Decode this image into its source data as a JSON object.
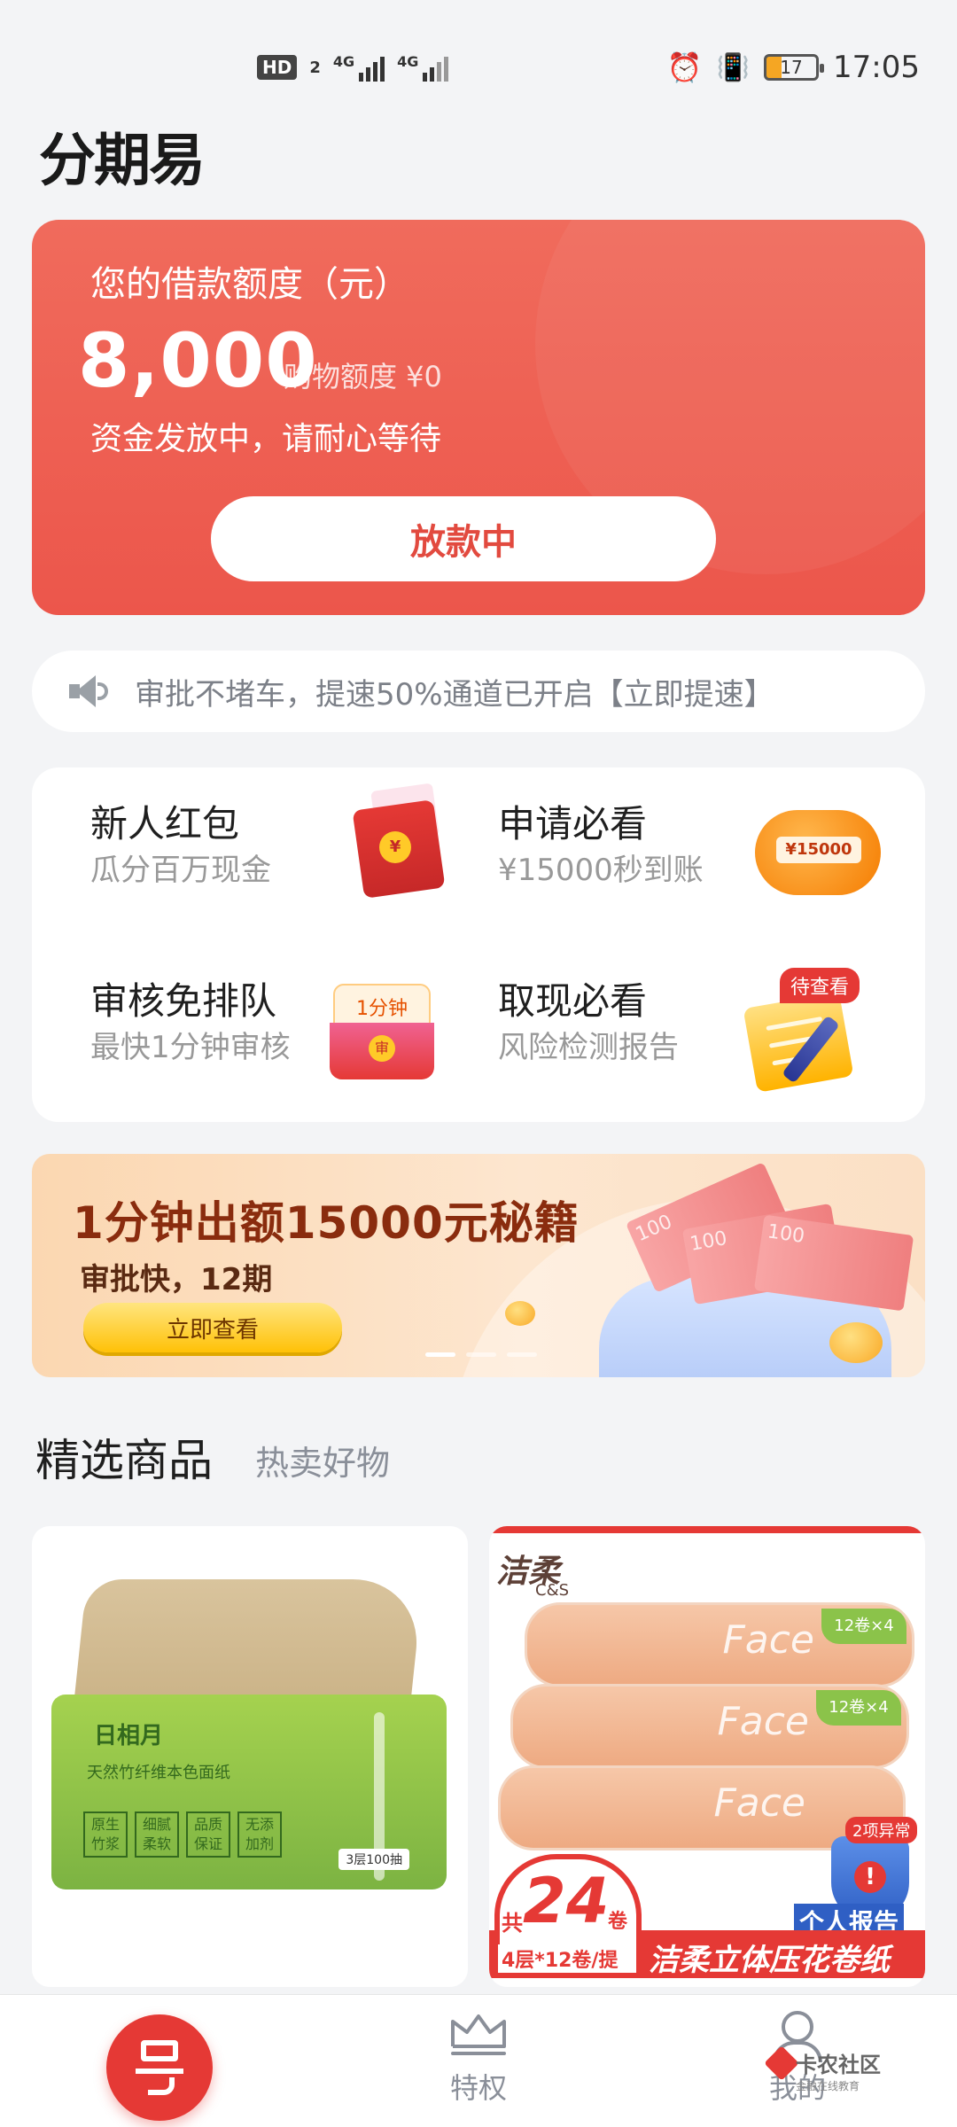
{
  "status_bar": {
    "hd": "HD",
    "sim": "2",
    "net1": "4G",
    "net2": "4G",
    "battery": "17",
    "time": "17:05"
  },
  "app": {
    "logo": "分期易"
  },
  "credit": {
    "title": "您的借款额度（元）",
    "amount": "8,000",
    "shopping_quota": "购物额度 ¥0",
    "status": "资金发放中，请耐心等待",
    "button": "放款中"
  },
  "notice": {
    "text": "审批不堵车，提速50%通道已开启【立即提速】"
  },
  "features": [
    {
      "title": "新人红包",
      "subtitle": "瓜分百万现金",
      "icon": "red-packet-icon",
      "coin": "¥"
    },
    {
      "title": "申请必看",
      "subtitle": "¥15000秒到账",
      "icon": "piggy-bank-icon",
      "label": "¥15000"
    },
    {
      "title": "审核免排队",
      "subtitle": "最快1分钟审核",
      "icon": "envelope-icon",
      "label": "1分钟",
      "seal": "审"
    },
    {
      "title": "取现必看",
      "subtitle": "风险检测报告",
      "icon": "notepad-icon",
      "badge": "待查看"
    }
  ],
  "banner": {
    "title": "1分钟出额15000元秘籍",
    "subtitle": "审批快，12期",
    "button": "立即查看",
    "bill_text": "100",
    "active_dot": 0,
    "dot_count": 3
  },
  "section": {
    "title": "精选商品",
    "subtitle": "热卖好物"
  },
  "products": [
    {
      "name": "tissue",
      "brand": "日相月",
      "desc": "天然竹纤维本色面纸",
      "tags": [
        "原生竹浆",
        "细腻柔软",
        "品质保证",
        "无添加剂"
      ],
      "count": "3层100抽"
    },
    {
      "name": "toilet-roll",
      "brand": "洁柔",
      "brand_en": "C&S",
      "face": "Face",
      "green_tag": "12卷×4",
      "promo_prefix": "共",
      "promo_num": "24",
      "promo_unit": "卷",
      "promo_spec": "4层*12卷/提",
      "promo_text": "洁柔立体压花卷纸",
      "alert_badge": "2项异常",
      "report": "个人报告"
    }
  ],
  "nav": {
    "privilege": "特权",
    "mine": "我的"
  },
  "watermark": {
    "name": "卡农社区",
    "sub": "金融在线教育"
  }
}
